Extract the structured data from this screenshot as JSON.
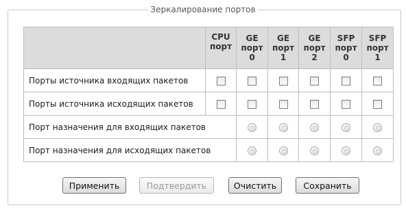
{
  "panel": {
    "title": "Зеркалирование портов"
  },
  "table": {
    "columns": [
      {
        "lines": [
          "CPU",
          "порт"
        ]
      },
      {
        "lines": [
          "GE",
          "порт",
          "0"
        ]
      },
      {
        "lines": [
          "GE",
          "порт",
          "1"
        ]
      },
      {
        "lines": [
          "GE",
          "порт",
          "2"
        ]
      },
      {
        "lines": [
          "SFP",
          "порт",
          "0"
        ]
      },
      {
        "lines": [
          "SFP",
          "порт",
          "1"
        ]
      }
    ],
    "rows": [
      {
        "label": "Порты источника входящих пакетов",
        "type": "checkbox",
        "cpu_cell": true,
        "values": [
          false,
          false,
          false,
          false,
          false,
          false
        ]
      },
      {
        "label": "Порты источника исходящих пакетов",
        "type": "checkbox",
        "cpu_cell": true,
        "values": [
          false,
          false,
          false,
          false,
          false,
          false
        ]
      },
      {
        "label": "Порт назначения для входящих пакетов",
        "type": "radio",
        "cpu_cell": false,
        "values": [
          false,
          false,
          false,
          false,
          false
        ]
      },
      {
        "label": "Порт назначения для исходящих пакетов",
        "type": "radio",
        "cpu_cell": false,
        "values": [
          false,
          false,
          false,
          false,
          false
        ]
      }
    ]
  },
  "buttons": {
    "apply": "Применить",
    "confirm": "Подтвердить",
    "clear": "Очистить",
    "save": "Сохранить"
  },
  "state": {
    "confirm_disabled": true
  }
}
